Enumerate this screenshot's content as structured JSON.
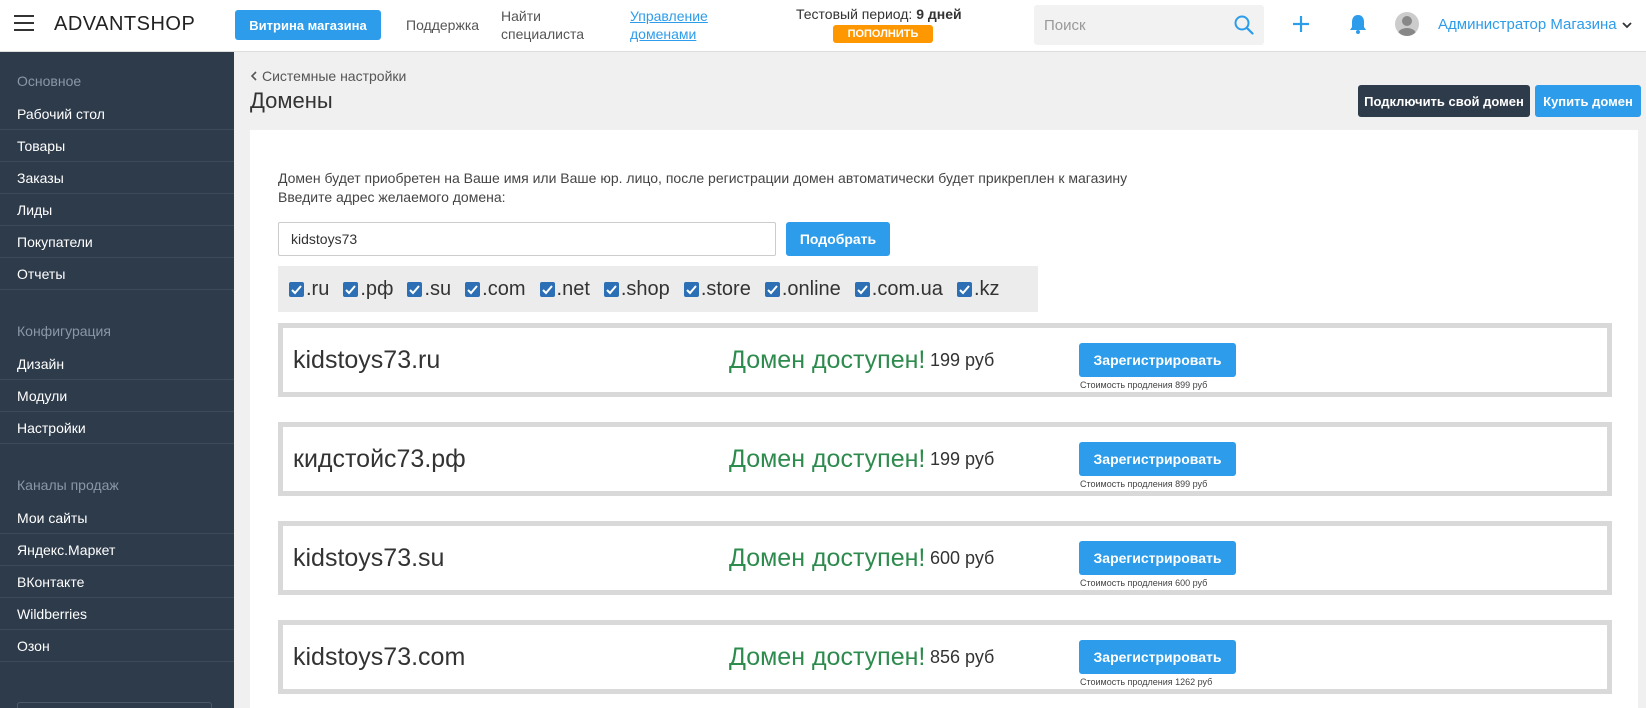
{
  "topbar": {
    "brand": "ADVANTSHOP",
    "store_button": "Витрина магазина",
    "support": "Поддержка",
    "find_specialist": "Найти специалиста",
    "domain_management": "Управление доменами",
    "trial_label": "Тестовый период:",
    "trial_days": "9 дней",
    "topup_button": "ПОПОЛНИТЬ",
    "search_placeholder": "Поиск",
    "admin_name": "Администратор Магазина"
  },
  "sidebar": {
    "sections": [
      {
        "title": "Основное",
        "items": [
          "Рабочий стол",
          "Товары",
          "Заказы",
          "Лиды",
          "Покупатели",
          "Отчеты"
        ]
      },
      {
        "title": "Конфигурация",
        "items": [
          "Дизайн",
          "Модули",
          "Настройки"
        ]
      },
      {
        "title": "Каналы продаж",
        "items": [
          "Мои сайты",
          "Яндекс.Маркет",
          "ВКонтакте",
          "Wildberries",
          "Озон"
        ]
      }
    ]
  },
  "page": {
    "breadcrumb": "Системные настройки",
    "title": "Домены",
    "connect_button": "Подключить свой домен",
    "buy_button": "Купить домен",
    "description_line1": "Домен будет приобретен на Ваше имя или Ваше юр. лицо, после регистрации домен автоматически будет прикреплен к магазину",
    "description_line2": "Введите адрес желаемого домена:",
    "domain_value": "kidstoys73",
    "pick_button": "Подобрать",
    "zones": [
      ".ru",
      ".рф",
      ".su",
      ".com",
      ".net",
      ".shop",
      ".store",
      ".online",
      ".com.ua",
      ".kz"
    ],
    "zones_checked": [
      true,
      true,
      true,
      true,
      true,
      true,
      true,
      true,
      true,
      true
    ]
  },
  "results": [
    {
      "name": "kidstoys73.ru",
      "status": "Домен доступен!",
      "price": "199 руб",
      "button": "Зарегистрировать",
      "renewal": "Стоимость продления 899 руб"
    },
    {
      "name": "кидстойс73.рф",
      "status": "Домен доступен!",
      "price": "199 руб",
      "button": "Зарегистрировать",
      "renewal": "Стоимость продления 899 руб"
    },
    {
      "name": "kidstoys73.su",
      "status": "Домен доступен!",
      "price": "600 руб",
      "button": "Зарегистрировать",
      "renewal": "Стоимость продления 600 руб"
    },
    {
      "name": "kidstoys73.com",
      "status": "Домен доступен!",
      "price": "856 руб",
      "button": "Зарегистрировать",
      "renewal": "Стоимость продления 1262 руб"
    }
  ],
  "colors": {
    "accent": "#2d9cea",
    "sidebar": "#2e3b4a",
    "available": "#2e8b4e",
    "topup": "#ff9800"
  }
}
